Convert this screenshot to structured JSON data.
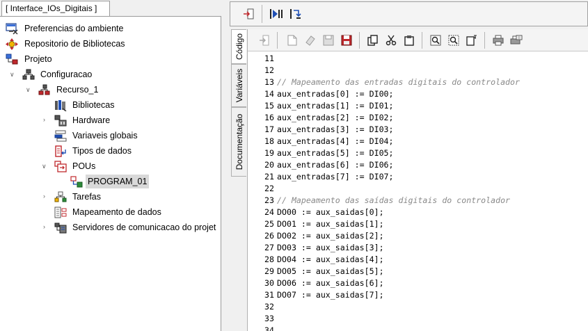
{
  "project_tab": {
    "title": "[ Interface_IOs_Digitais ]"
  },
  "tree": {
    "preferences": "Preferencias do ambiente",
    "libraries_repo": "Repositorio de Bibliotecas",
    "project": "Projeto",
    "configuration": "Configuracao",
    "resource": "Recurso_1",
    "libraries": "Bibliotecas",
    "hardware": "Hardware",
    "global_vars": "Variaveis globais",
    "data_types": "Tipos de dados",
    "pous": "POUs",
    "program": "PROGRAM_01",
    "tasks": "Tarefas",
    "data_mapping": "Mapeamento de dados",
    "comm_servers": "Servidores de comunicacao do projet"
  },
  "side_tabs": {
    "code": "Código",
    "variables": "Variáveis",
    "documentation": "Documentação"
  },
  "code_lines": [
    {
      "n": "11",
      "text": "",
      "comment": false
    },
    {
      "n": "12",
      "text": "",
      "comment": false
    },
    {
      "n": "13",
      "text": "// Mapeamento das entradas digitais do controlador",
      "comment": true
    },
    {
      "n": "14",
      "text": "aux_entradas[0] := DI00;",
      "comment": false
    },
    {
      "n": "15",
      "text": "aux_entradas[1] := DI01;",
      "comment": false
    },
    {
      "n": "16",
      "text": "aux_entradas[2] := DI02;",
      "comment": false
    },
    {
      "n": "17",
      "text": "aux_entradas[3] := DI03;",
      "comment": false
    },
    {
      "n": "18",
      "text": "aux_entradas[4] := DI04;",
      "comment": false
    },
    {
      "n": "19",
      "text": "aux_entradas[5] := DI05;",
      "comment": false
    },
    {
      "n": "20",
      "text": "aux_entradas[6] := DI06;",
      "comment": false
    },
    {
      "n": "21",
      "text": "aux_entradas[7] := DI07;",
      "comment": false
    },
    {
      "n": "22",
      "text": "",
      "comment": false
    },
    {
      "n": "23",
      "text": "// Mapeamento das saídas digitais do controlador",
      "comment": true
    },
    {
      "n": "24",
      "text": "DO00 := aux_saidas[0];",
      "comment": false
    },
    {
      "n": "25",
      "text": "DO01 := aux_saidas[1];",
      "comment": false
    },
    {
      "n": "26",
      "text": "DO02 := aux_saidas[2];",
      "comment": false
    },
    {
      "n": "27",
      "text": "DO03 := aux_saidas[3];",
      "comment": false
    },
    {
      "n": "28",
      "text": "DO04 := aux_saidas[4];",
      "comment": false
    },
    {
      "n": "29",
      "text": "DO05 := aux_saidas[5];",
      "comment": false
    },
    {
      "n": "30",
      "text": "DO06 := aux_saidas[6];",
      "comment": false
    },
    {
      "n": "31",
      "text": "DO07 := aux_saidas[7];",
      "comment": false
    },
    {
      "n": "32",
      "text": "",
      "comment": false
    },
    {
      "n": "33",
      "text": "",
      "comment": false
    },
    {
      "n": "34",
      "text": "",
      "comment": false
    }
  ],
  "icons": {
    "top_toolbar": [
      "exit-icon",
      "run-icon",
      "step-icon"
    ],
    "edit_toolbar": [
      "exit-icon",
      "new-file-icon",
      "eraser-icon",
      "save-icon",
      "save-all-icon",
      "copy-icon",
      "cut-icon",
      "paste-icon",
      "find-icon",
      "replace-icon",
      "goto-icon",
      "print-icon",
      "print-preview-icon"
    ]
  },
  "colors": {
    "comment": "#8a8a8a",
    "selection": "#d9d9d9",
    "accent_red": "#c0282d",
    "accent_blue": "#1f4fb5"
  }
}
